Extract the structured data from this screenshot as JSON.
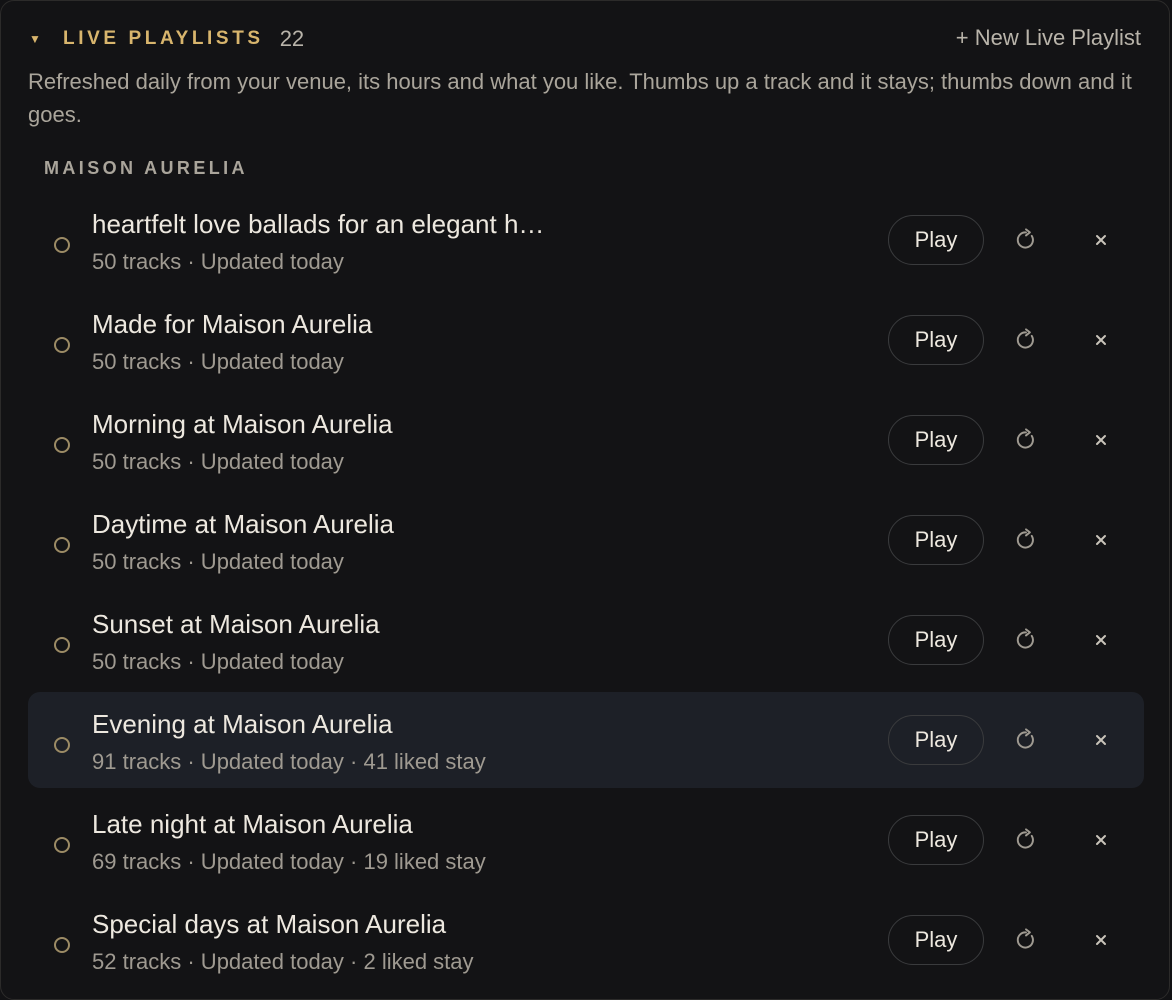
{
  "section": {
    "title": "LIVE PLAYLISTS",
    "count": "22",
    "new_label": "+ New Live Playlist",
    "description": "Refreshed daily from your venue, its hours and what you like. Thumbs up a track and it stays; thumbs down and it goes.",
    "venue": "MAISON AURELIA"
  },
  "colors": {
    "accent": "#d8b56d",
    "background": "#131315",
    "active_row": "#1d2027"
  },
  "icons": {
    "collapse": "caret-down-icon",
    "select": "circle-outline-icon",
    "refresh": "refresh-icon",
    "remove": "close-icon"
  },
  "playlists": [
    {
      "title": "heartfelt love ballads for an elegant h…",
      "meta": "50 tracks · Updated today",
      "play_label": "Play",
      "active": false
    },
    {
      "title": "Made for Maison Aurelia",
      "meta": "50 tracks · Updated today",
      "play_label": "Play",
      "active": false
    },
    {
      "title": "Morning at Maison Aurelia",
      "meta": "50 tracks · Updated today",
      "play_label": "Play",
      "active": false
    },
    {
      "title": "Daytime at Maison Aurelia",
      "meta": "50 tracks · Updated today",
      "play_label": "Play",
      "active": false
    },
    {
      "title": "Sunset at Maison Aurelia",
      "meta": "50 tracks · Updated today",
      "play_label": "Play",
      "active": false
    },
    {
      "title": "Evening at Maison Aurelia",
      "meta": "91 tracks · Updated today · 41 liked stay",
      "play_label": "Play",
      "active": true
    },
    {
      "title": "Late night at Maison Aurelia",
      "meta": "69 tracks · Updated today · 19 liked stay",
      "play_label": "Play",
      "active": false
    },
    {
      "title": "Special days at Maison Aurelia",
      "meta": "52 tracks · Updated today · 2 liked stay",
      "play_label": "Play",
      "active": false
    }
  ]
}
